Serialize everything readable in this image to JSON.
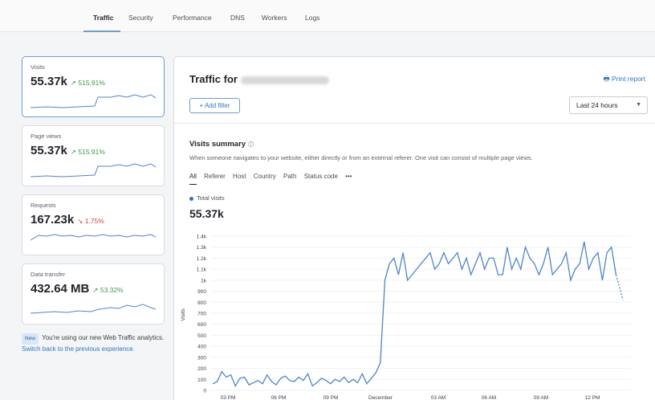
{
  "nav": {
    "tabs": [
      "Traffic",
      "Security",
      "Performance",
      "DNS",
      "Workers",
      "Logs"
    ],
    "active": "Traffic"
  },
  "cards": [
    {
      "label": "Visits",
      "value": "55.37k",
      "change": "515.91%",
      "direction": "up"
    },
    {
      "label": "Page views",
      "value": "55.37k",
      "change": "515.91%",
      "direction": "up"
    },
    {
      "label": "Requests",
      "value": "167.23k",
      "change": "1.75%",
      "direction": "down"
    },
    {
      "label": "Data transfer",
      "value": "432.64 MB",
      "change": "53.32%",
      "direction": "up"
    }
  ],
  "note": {
    "badge": "New",
    "text": "You're using our new Web Traffic analytics.",
    "link": "Switch back to the previous experience."
  },
  "main": {
    "title": "Traffic for",
    "print_report": "Print report",
    "add_filter": "+ Add filter",
    "time_range": "Last 24 hours"
  },
  "summary": {
    "title": "Visits summary",
    "description": "When someone navigates to your website, either directly or from an external referer. One visit can consist of multiple page views.",
    "filters": [
      "All",
      "Referer",
      "Host",
      "Country",
      "Path",
      "Status code",
      "•••"
    ],
    "legend": "Total visits",
    "total": "55.37k"
  },
  "colors": {
    "accent": "#2f76c4",
    "line": "#4f86c6",
    "up": "#3c9a4c",
    "down": "#d14343"
  },
  "chart_data": {
    "type": "line",
    "ylabel": "Visits",
    "yticks": [
      "0",
      "100",
      "200",
      "300",
      "400",
      "500",
      "600",
      "700",
      "800",
      "900",
      "1k",
      "1.1k",
      "1.2k",
      "1.3k",
      "1.4k"
    ],
    "ylim": [
      0,
      1400
    ],
    "xticks": [
      "03 PM",
      "06 PM",
      "09 PM",
      "December",
      "03 AM",
      "06 AM",
      "09 AM",
      "12 PM"
    ],
    "series": [
      {
        "name": "Total visits",
        "values": [
          60,
          80,
          170,
          120,
          140,
          40,
          110,
          120,
          50,
          70,
          90,
          60,
          140,
          80,
          50,
          110,
          130,
          90,
          80,
          120,
          90,
          150,
          40,
          70,
          110,
          90,
          60,
          100,
          80,
          120,
          70,
          100,
          70,
          150,
          60,
          110,
          160,
          250,
          1000,
          1150,
          1200,
          1050,
          1250,
          1000,
          1050,
          1100,
          1150,
          1200,
          1250,
          1100,
          1150,
          1250,
          1150,
          1200,
          1250,
          1100,
          1200,
          1050,
          1150,
          1250,
          1100,
          1200,
          1200,
          1050,
          1050,
          1300,
          1100,
          1200,
          1100,
          1300,
          1200,
          1150,
          1050,
          1150,
          1300,
          1050,
          1100,
          1150,
          1250,
          1000,
          1100,
          1150,
          1350,
          1100,
          1200,
          1250,
          1000,
          1250,
          1300,
          1050,
          900
        ]
      }
    ]
  }
}
